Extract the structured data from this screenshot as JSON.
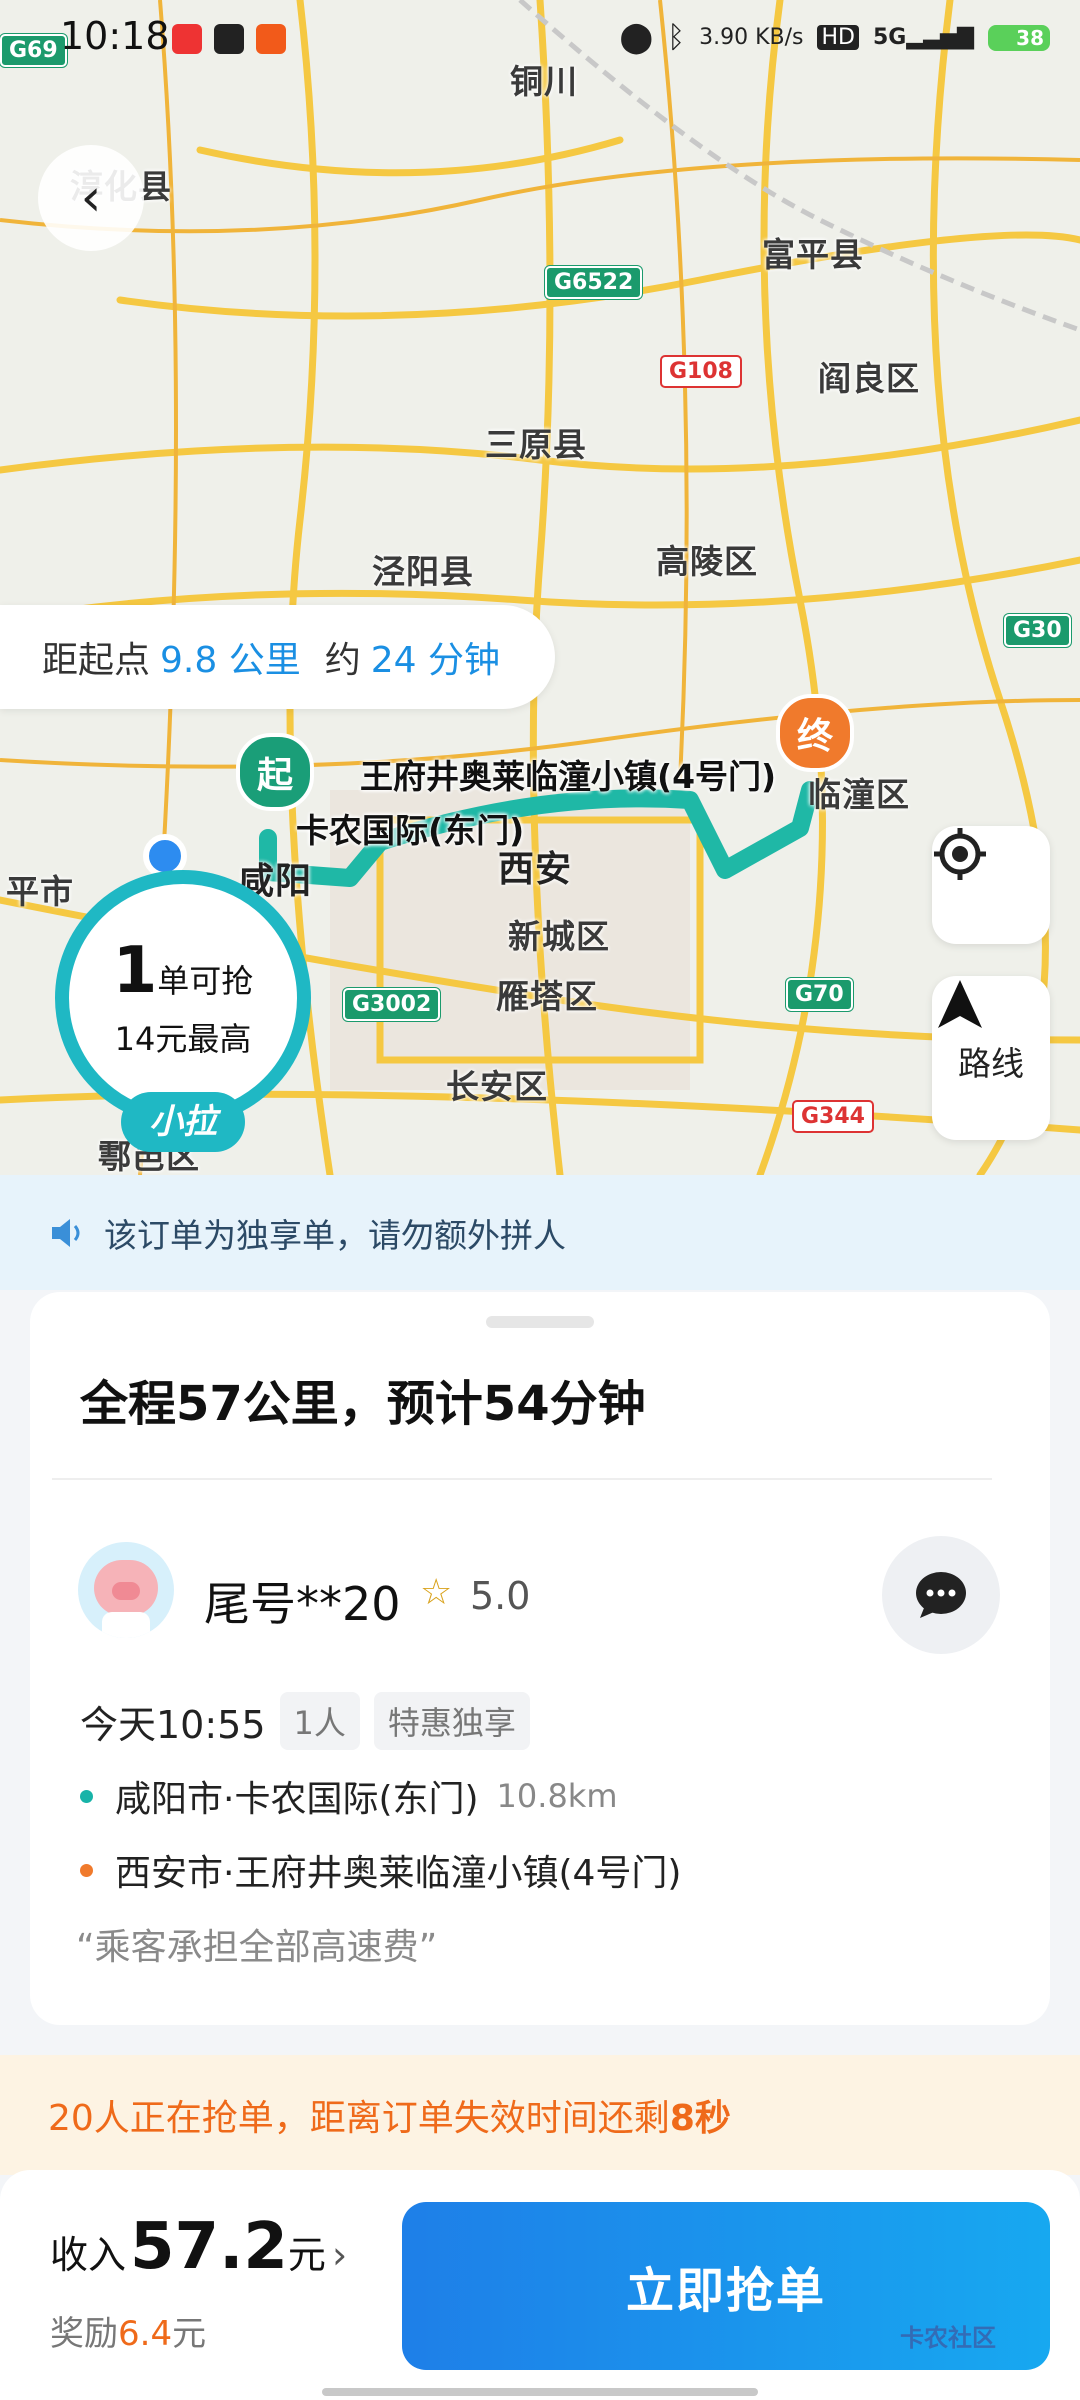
{
  "status_bar": {
    "time": "10:18",
    "net_speed": "3.90 KB/s",
    "battery": "38",
    "icons": [
      "location-icon",
      "bluetooth-icon",
      "hd-icon",
      "5g-signal-icon",
      "battery-icon"
    ]
  },
  "map": {
    "cities": [
      "淳化县",
      "铜川",
      "富平县",
      "阎良区",
      "三原县",
      "泾阳县",
      "高陵区",
      "临潼区",
      "咸阳",
      "西安",
      "新城区",
      "雁塔区",
      "长安区",
      "鄠邑区",
      "平市"
    ],
    "shields": [
      "G69",
      "G6522",
      "G108",
      "G30",
      "G3002",
      "G70",
      "G344"
    ],
    "start_marker": "起",
    "end_marker": "终",
    "start_place": "卡农国际(东门)",
    "end_place": "王府井奥莱临潼小镇(4号门)",
    "distance_pill": {
      "prefix": "距起点",
      "distance": "9.8 公里",
      "time_prefix": "约",
      "time": "24 分钟"
    },
    "route_button_label": "路线",
    "badge": {
      "count": "1",
      "count_suffix": "单可抢",
      "max_price": "14元最高",
      "brand": "小拉"
    }
  },
  "notice": {
    "text": "该订单为独享单，请勿额外拼人"
  },
  "order": {
    "summary": "全程57公里，预计54分钟",
    "passenger": {
      "name": "尾号**20",
      "rating": "5.0"
    },
    "time": "今天10:55",
    "tags": [
      "1人",
      "特惠独享"
    ],
    "pickup": {
      "address": "咸阳市·卡农国际(东门)",
      "distance": "10.8km",
      "color": "#18b3a8"
    },
    "dropoff": {
      "address": "西安市·王府井奥莱临潼小镇(4号门)",
      "color": "#f07a2c"
    },
    "remark": "“乘客承担全部高速费”"
  },
  "urgent": {
    "prefix": "20人正在抢单，距离订单失效时间还剩",
    "seconds": "8秒"
  },
  "bottom": {
    "income_label": "收入",
    "income_value": "57.2",
    "income_unit": "元",
    "bonus_label": "奖励",
    "bonus_value": "6.4",
    "bonus_unit": "元",
    "grab_button": "立即抢单"
  },
  "watermark": "卡农社区",
  "colors": {
    "accent_blue": "#1a8fe3",
    "route_teal": "#1fb8a6",
    "urgent_orange": "#ef6a1a"
  }
}
